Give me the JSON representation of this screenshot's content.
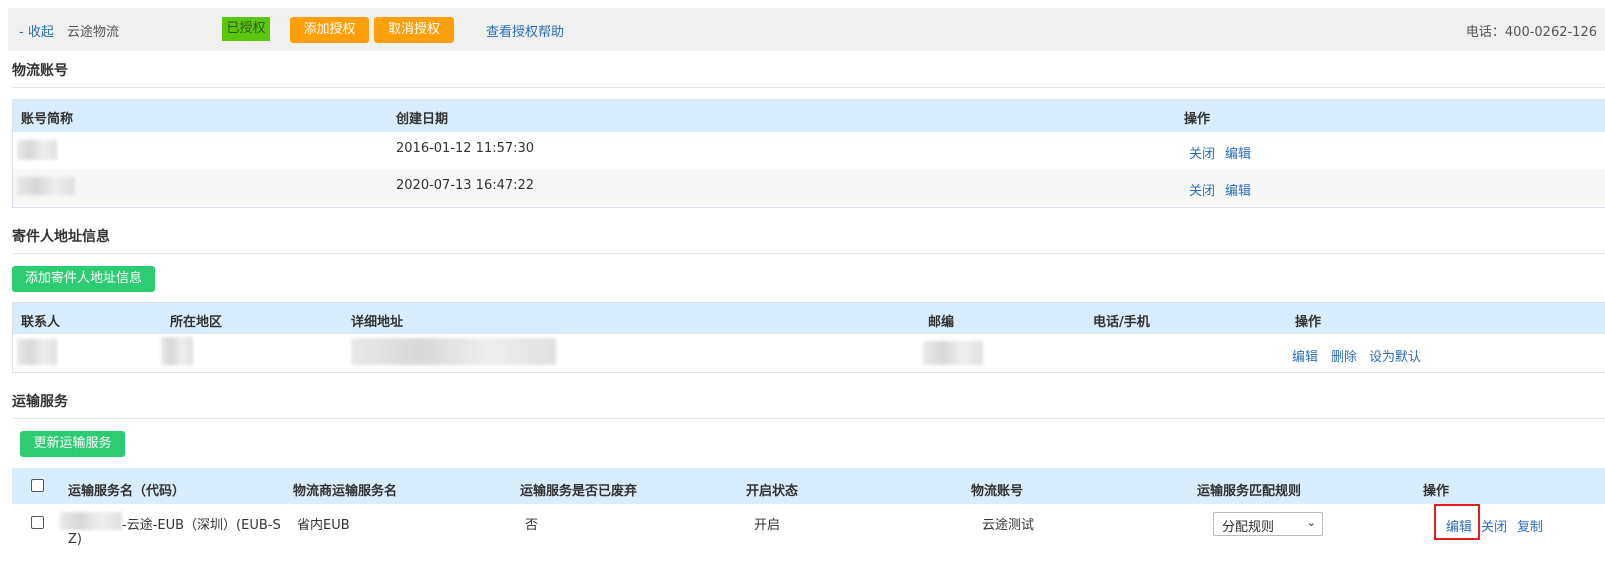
{
  "header": {
    "collapse": "- 收起",
    "app_name": "云途物流",
    "auth_status": "已授权",
    "add_auth": "添加授权",
    "cancel_auth": "取消授权",
    "help": "查看授权帮助",
    "phone": "电话：400-0262-126"
  },
  "accounts": {
    "title": "物流账号",
    "columns": [
      "账号简称",
      "创建日期",
      "操作"
    ],
    "rows": [
      {
        "name": "",
        "created": "2016-01-12 11:57:30",
        "close": "关闭",
        "edit": "编辑"
      },
      {
        "name": "",
        "created": "2020-07-13 16:47:22",
        "close": "关闭",
        "edit": "编辑"
      }
    ]
  },
  "sender": {
    "title": "寄件人地址信息",
    "add_button": "添加寄件人地址信息",
    "columns": [
      "联系人",
      "所在地区",
      "详细地址",
      "邮编",
      "电话/手机",
      "操作"
    ],
    "row": {
      "edit": "编辑",
      "delete": "删除",
      "set_default": "设为默认"
    }
  },
  "shipping": {
    "title": "运输服务",
    "update_button": "更新运输服务",
    "columns": [
      "运输服务名（代码）",
      "物流商运输服务名",
      "运输服务是否已废弃",
      "开启状态",
      "物流账号",
      "运输服务匹配规则",
      "操作"
    ],
    "row": {
      "service_name_line1": "-云途-EUB（深圳）(EUB-S",
      "service_name_line2": "Z)",
      "carrier_name": "省内EUB",
      "deprecated": "否",
      "status": "开启",
      "account": "云途测试",
      "rule_selected": "分配规则",
      "edit": "编辑",
      "close": "关闭",
      "copy": "复制"
    }
  },
  "colors": {
    "link": "#2b6fb6",
    "orange": "#ff9f0a",
    "green": "#2ecc71",
    "auth_badge": "#5bc60e",
    "table_header": "#d9ecfb",
    "highlight": "#e02020"
  }
}
